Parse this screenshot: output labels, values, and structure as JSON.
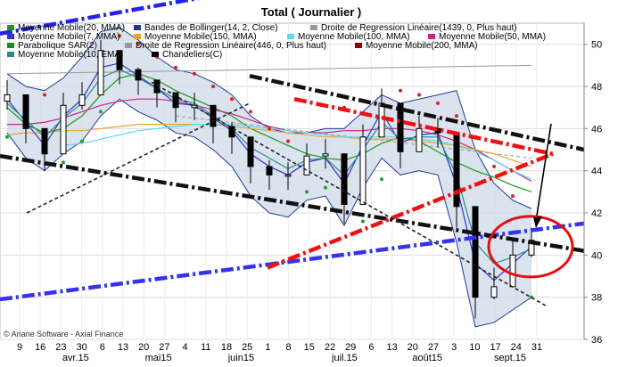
{
  "chart_data": {
    "type": "line",
    "title": "Total  ( Journalier )",
    "watermark": "© Ariane Software - Axial Finance",
    "ylim": [
      36,
      51
    ],
    "yticks": [
      36,
      38,
      40,
      42,
      44,
      46,
      48,
      50
    ],
    "grid": true,
    "legend_position": "top-left",
    "x_day_ticks": [
      "9",
      "16",
      "23",
      "30",
      "6",
      "13",
      "20",
      "27",
      "4",
      "11",
      "18",
      "25",
      "1",
      "8",
      "15",
      "22",
      "29",
      "6",
      "13",
      "20",
      "27",
      "3",
      "10",
      "17",
      "24",
      "31"
    ],
    "x_month_labels": [
      "avr.15",
      "mai15",
      "juin15",
      "juil.15",
      "août15",
      "sept.15"
    ],
    "legend": [
      {
        "label": "Moyenne Mobile(20, MMA)",
        "color": "#1a9a1a"
      },
      {
        "label": "Bandes de Bollinger(14, 2, Close)",
        "color": "#1f3a93"
      },
      {
        "label": "Droite de Regression Linéaire(1439, 0, Plus haut)",
        "color": "#999999"
      },
      {
        "label": "Moyenne Mobile(7, MMA)",
        "color": "#3333cc"
      },
      {
        "label": "Moyenne Mobile(150, MMA)",
        "color": "#f0a030"
      },
      {
        "label": "Moyenne Mobile(100, MMA)",
        "color": "#55ddee"
      },
      {
        "label": "Moyenne Mobile(50, MMA)",
        "color": "#cc2288"
      },
      {
        "label": "Parabolique SAR(2)",
        "color": "#228822"
      },
      {
        "label": "Droite de Regression Linéaire(446, 0, Plus haut)",
        "color": "#999999"
      },
      {
        "label": "Moyenne Mobile(200, MMA)",
        "color": "#8b0000"
      },
      {
        "label": "Moyenne Mobile(10, EMA)",
        "color": "#2a8a8a"
      },
      {
        "label": "Chandeliers(C)",
        "color": "#000000"
      }
    ],
    "series": [
      {
        "name": "Moyenne Mobile(20, MMA)",
        "color": "#1a9a1a",
        "values": [
          47.0,
          46.2,
          45.8,
          46.0,
          46.6,
          47.6,
          48.4,
          48.6,
          48.3,
          47.8,
          47.4,
          47.0,
          46.6,
          46.0,
          45.6,
          45.2,
          44.8,
          44.6,
          44.5,
          44.8,
          45.3,
          45.6,
          45.4,
          44.9,
          44.4,
          44.0,
          43.7,
          43.3,
          43.0
        ]
      },
      {
        "name": "Moyenne Mobile(50, MMA)",
        "color": "#cc2288",
        "values": [
          46.2,
          46.2,
          46.3,
          46.5,
          46.8,
          47.1,
          47.3,
          47.4,
          47.4,
          47.3,
          47.1,
          46.9,
          46.7,
          46.4,
          46.1,
          45.9,
          45.8,
          45.8,
          45.9,
          45.9,
          46.0,
          46.0,
          45.9,
          45.7,
          45.4,
          45.0,
          44.5,
          44.0,
          43.5
        ]
      },
      {
        "name": "Moyenne Mobile(150, MMA)",
        "color": "#f0a030",
        "values": [
          45.7,
          45.8,
          45.8,
          45.9,
          45.9,
          46.0,
          46.1,
          46.2,
          46.2,
          46.2,
          46.2,
          46.2,
          46.1,
          46.0,
          45.9,
          45.8,
          45.7,
          45.6,
          45.6,
          45.5,
          45.5,
          45.5,
          45.4,
          45.3,
          45.2,
          45.0,
          44.8,
          44.5,
          44.2
        ]
      },
      {
        "name": "Moyenne Mobile(100, MMA)",
        "color": "#55ddee",
        "values": [
          null,
          null,
          null,
          45.2,
          45.3,
          45.5,
          45.7,
          45.9,
          46.0,
          46.1,
          46.2,
          46.2,
          46.2,
          46.1,
          46.0,
          45.9,
          45.8,
          45.7,
          45.6,
          45.6,
          45.6,
          45.6,
          45.5,
          45.4,
          45.2,
          44.9,
          44.5,
          44.0,
          43.6
        ]
      },
      {
        "name": "Moyenne Mobile(7, MMA)",
        "color": "#3333cc",
        "values": [
          47.4,
          46.3,
          45.2,
          46.6,
          47.4,
          48.9,
          49.1,
          48.5,
          47.9,
          47.2,
          47.1,
          46.5,
          45.9,
          44.8,
          44.2,
          43.8,
          44.4,
          44.6,
          43.4,
          45.2,
          46.8,
          45.3,
          45.7,
          45.8,
          43.3,
          39.6,
          38.8,
          39.6,
          40.4
        ]
      },
      {
        "name": "Moyenne Mobile(10, EMA)",
        "color": "#2a8a8a",
        "values": [
          47.2,
          46.4,
          45.6,
          46.5,
          47.2,
          48.4,
          48.8,
          48.4,
          47.9,
          47.4,
          47.2,
          46.6,
          46.0,
          45.1,
          44.6,
          44.1,
          44.5,
          44.6,
          43.8,
          45.0,
          46.3,
          45.5,
          45.6,
          45.6,
          43.8,
          40.6,
          39.6,
          39.9,
          40.3
        ]
      }
    ],
    "bollinger": {
      "upper": [
        48.6,
        48.0,
        47.8,
        48.4,
        49.4,
        50.6,
        50.8,
        50.2,
        49.4,
        48.8,
        48.6,
        48.2,
        47.6,
        46.6,
        46.0,
        45.8,
        45.8,
        46.0,
        46.0,
        46.8,
        47.6,
        47.2,
        47.4,
        47.6,
        47.8,
        45.0,
        43.4,
        42.6,
        42.2
      ],
      "lower": [
        45.8,
        44.6,
        44.0,
        44.8,
        45.4,
        46.6,
        47.4,
        46.8,
        46.4,
        45.8,
        45.6,
        45.0,
        44.2,
        42.8,
        42.0,
        41.8,
        42.6,
        42.8,
        41.4,
        43.2,
        44.6,
        43.8,
        44.0,
        43.8,
        40.6,
        36.6,
        36.8,
        37.4,
        38.0
      ]
    },
    "candles": {
      "close": [
        47.6,
        46.0,
        44.8,
        47.1,
        47.6,
        49.7,
        48.8,
        48.3,
        47.7,
        47.0,
        47.1,
        46.1,
        45.6,
        44.2,
        43.8,
        43.8,
        44.7,
        44.8,
        42.4,
        45.6,
        47.2,
        44.9,
        46.0,
        45.8,
        42.3,
        38.0,
        38.5,
        40.0,
        40.7
      ],
      "high": [
        48.3,
        46.9,
        45.6,
        47.7,
        48.2,
        50.2,
        49.6,
        48.9,
        48.3,
        47.7,
        47.7,
        46.8,
        46.3,
        45.1,
        44.5,
        44.4,
        45.3,
        45.5,
        43.3,
        46.2,
        47.9,
        45.7,
        46.6,
        46.5,
        43.1,
        39.4,
        39.4,
        40.8,
        41.3
      ],
      "low": [
        46.9,
        45.3,
        44.0,
        46.4,
        46.9,
        49.0,
        48.1,
        47.6,
        47.0,
        46.3,
        46.4,
        45.3,
        44.8,
        43.4,
        43.1,
        43.1,
        44.0,
        44.1,
        41.5,
        44.9,
        46.5,
        44.1,
        45.3,
        45.1,
        41.3,
        37.0,
        37.9,
        39.2,
        39.9
      ]
    },
    "sar": {
      "above": [
        null,
        null,
        47.6,
        null,
        null,
        null,
        50.4,
        50.0,
        49.4,
        48.9,
        48.6,
        48.0,
        47.4,
        46.8,
        46.0,
        45.4,
        null,
        null,
        47.0,
        null,
        null,
        47.8,
        47.6,
        47.2,
        46.6,
        45.6,
        44.2,
        42.8,
        null
      ],
      "below": [
        45.6,
        null,
        null,
        44.4,
        45.4,
        46.8,
        null,
        null,
        null,
        null,
        null,
        null,
        null,
        null,
        null,
        null,
        43.0,
        43.2,
        null,
        41.6,
        43.6,
        null,
        null,
        null,
        null,
        null,
        null,
        null,
        38.0
      ]
    },
    "regression_lines": {
      "lr_1439": [
        48.6,
        49.0
      ],
      "lr_446": [
        46.6,
        44.6
      ]
    },
    "annotations": {
      "ellipse_center": [
        29,
        40.4
      ]
    }
  }
}
